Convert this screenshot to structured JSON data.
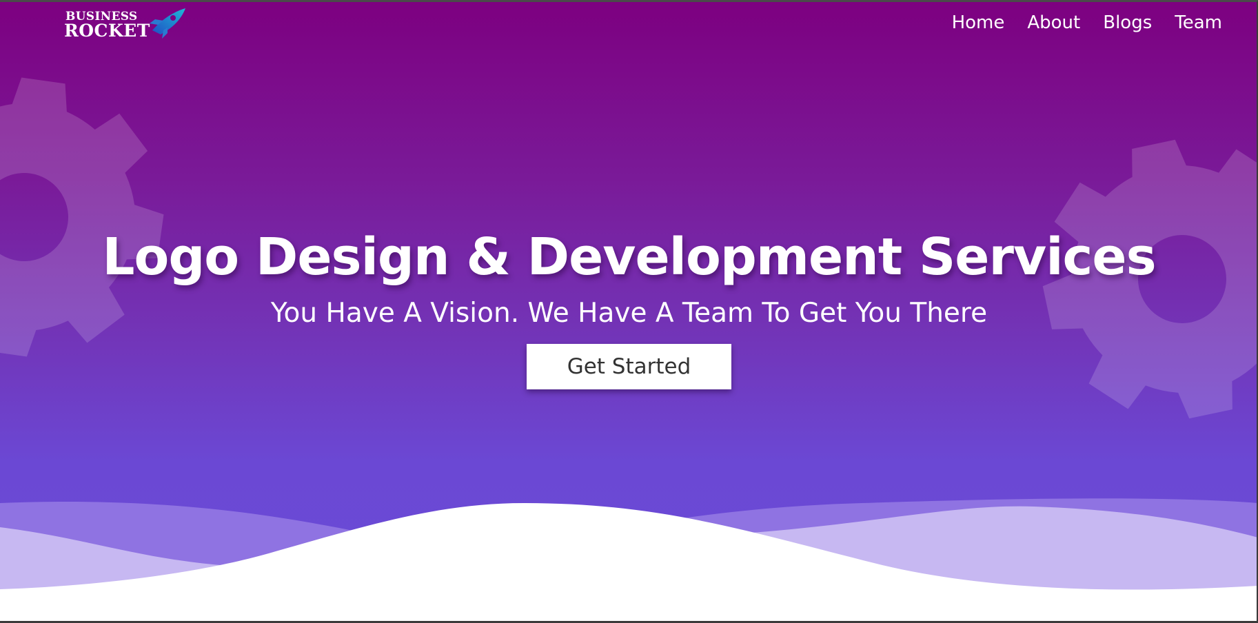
{
  "brand": {
    "line1": "BUSINESS",
    "line2": "ROCKET"
  },
  "nav": {
    "items": [
      {
        "label": "Home"
      },
      {
        "label": "About"
      },
      {
        "label": "Blogs"
      },
      {
        "label": "Team"
      }
    ]
  },
  "hero": {
    "title": "Logo Design & Development Services",
    "subtitle": "You Have A Vision. We Have A Team To Get You There",
    "cta_label": "Get Started"
  },
  "colors": {
    "gradient_top": "#7d0080",
    "gradient_bottom": "#6a4bd6",
    "text": "#ffffff",
    "button_text": "#333333",
    "wave_light": "#c7b8f2",
    "wave_mid": "#8f73e2"
  },
  "icons": {
    "gear": "gear-icon",
    "rocket": "rocket-icon"
  }
}
